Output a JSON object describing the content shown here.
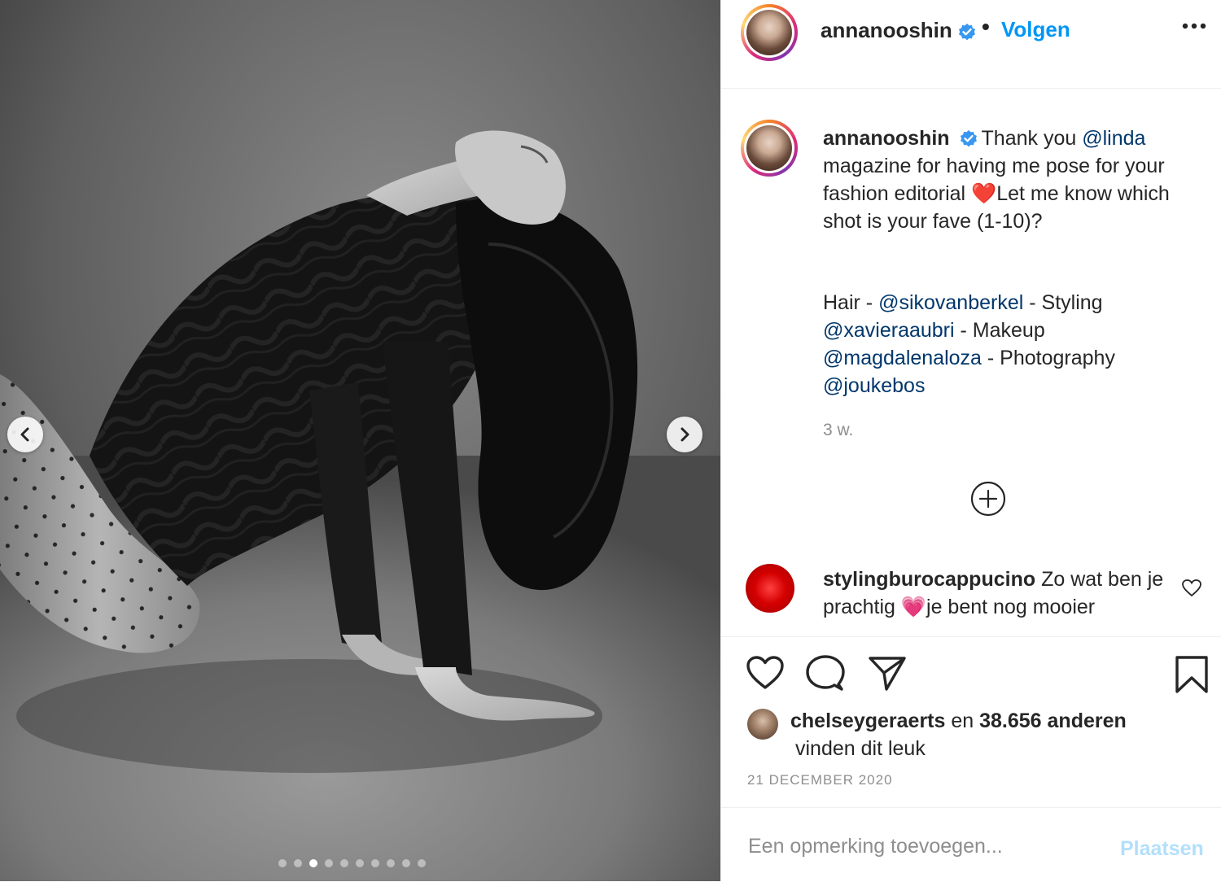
{
  "post": {
    "author": "annanooshin",
    "follow_separator": "•",
    "follow_label": "Volgen",
    "caption": {
      "username": "annanooshin",
      "line1_before": "Thank you ",
      "mention_linda": "@linda",
      "line2": "magazine for having me pose for your",
      "line3_before": "fashion editorial ",
      "heart_emoji": "❤️",
      "line3_after": "Let me know which",
      "line4": "shot is your fave (1-10)?",
      "credits": {
        "hair_label": "Hair - ",
        "hair_mention": "@sikovanberkel",
        "styling_label": " - Styling",
        "styling_mention": "@xavieraaubri",
        "makeup_label": " - Makeup",
        "makeup_mention": "@magdalenaloza",
        "photo_label": " - Photography",
        "photo_mention": "@joukebos"
      }
    },
    "time_ago": "3 w.",
    "comment": {
      "username": "stylingburocappucino",
      "text_before": " Zo wat ben je prachtig ",
      "emoji": "💗",
      "text_after": "je bent nog mooier"
    },
    "likes": {
      "first_liker": "chelseygeraerts",
      "joiner": " en ",
      "others": "38.656 anderen",
      "suffix": "vinden dit leuk"
    },
    "date": "21 DECEMBER 2020",
    "add_comment_placeholder": "Een opmerking toevoegen...",
    "post_button": "Plaatsen",
    "carousel": {
      "slide_count": 10,
      "active_index": 2
    }
  },
  "icons": {
    "verified": "verified-badge-icon",
    "more": "more-options-icon",
    "prev": "chevron-left-icon",
    "next": "chevron-right-icon",
    "load_more": "plus-circle-icon",
    "like": "heart-icon",
    "comment": "comment-bubble-icon",
    "share": "paper-plane-icon",
    "save": "bookmark-icon",
    "comment_like": "small-heart-icon"
  },
  "colors": {
    "accent_blue": "#0095f6",
    "mention_blue": "#00376b",
    "muted_gray": "#8e8e8e",
    "post_disabled": "#b2dffc",
    "verified_blue": "#3897f0"
  }
}
